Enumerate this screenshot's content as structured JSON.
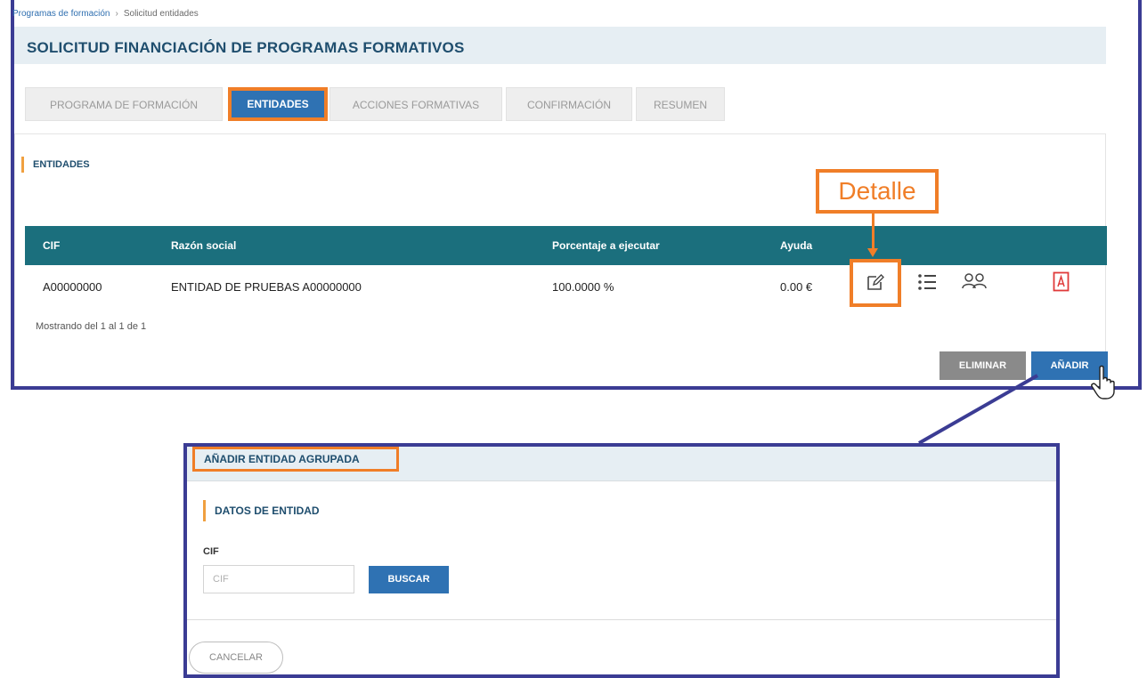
{
  "breadcrumb": {
    "parent": "Programas de formación",
    "separator": "›",
    "current": "Solicitud entidades"
  },
  "page_title": "SOLICITUD FINANCIACIÓN DE PROGRAMAS FORMATIVOS",
  "tabs": [
    {
      "label": "PROGRAMA DE FORMACIÓN",
      "active": false
    },
    {
      "label": "ENTIDADES",
      "active": true
    },
    {
      "label": "ACCIONES FORMATIVAS",
      "active": false
    },
    {
      "label": "CONFIRMACIÓN",
      "active": false
    },
    {
      "label": "RESUMEN",
      "active": false
    }
  ],
  "section_title": "ENTIDADES",
  "callout_label": "Detalle",
  "table": {
    "headers": {
      "cif": "CIF",
      "razon": "Razón social",
      "porcentaje": "Porcentaje a ejecutar",
      "ayuda": "Ayuda"
    },
    "rows": [
      {
        "cif": "A00000000",
        "razon": "ENTIDAD DE PRUEBAS A00000000",
        "porcentaje": "100.0000 %",
        "ayuda": "0.00 €"
      }
    ],
    "row_icons": [
      "edit-icon",
      "list-icon",
      "users-icon",
      "pdf-icon"
    ]
  },
  "showing_text": "Mostrando del 1 al 1 de 1",
  "buttons": {
    "eliminar": "ELIMINAR",
    "anadir": "AÑADIR"
  },
  "modal": {
    "title": "AÑADIR ENTIDAD AGRUPADA",
    "section_title": "DATOS DE ENTIDAD",
    "cif_label": "CIF",
    "cif_placeholder": "CIF",
    "cif_value": "",
    "buscar": "BUSCAR",
    "cancelar": "CANCELAR"
  },
  "colors": {
    "frame": "#3b3c94",
    "highlight": "#f07e28",
    "primary": "#2f72b3",
    "table_header": "#1b6f7d",
    "pdf": "#e03a3a"
  }
}
